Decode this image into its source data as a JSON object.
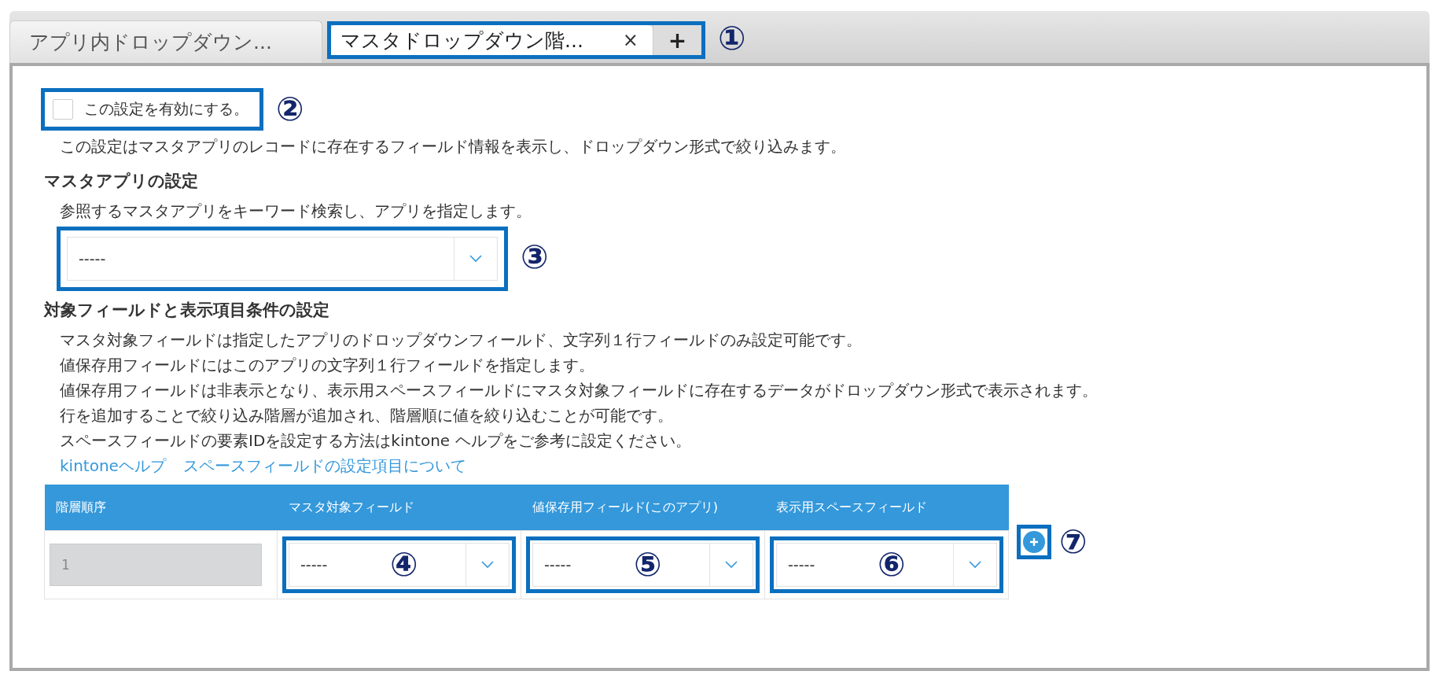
{
  "tab_bar": {
    "tabs": [
      {
        "label": "アプリ内ドロップダウン...",
        "selected": false
      },
      {
        "label": "マスタドロップダウン階...",
        "selected": true,
        "close": "×"
      }
    ],
    "add_button": "+",
    "callout": "①"
  },
  "enable": {
    "label": "この設定を有効にする。",
    "checked": false,
    "callout": "②"
  },
  "description": "この設定はマスタアプリのレコードに存在するフィールド情報を表示し、ドロップダウン形式で絞り込みます。",
  "app_section": {
    "heading": "マスタアプリの設定",
    "lines": [
      "参照するマスタアプリをキーワード検索し、アプリを指定します。"
    ],
    "dropdown": {
      "value": "-----",
      "callout": "③"
    }
  },
  "field_section": {
    "heading": "対象フィールドと表示項目条件の設定",
    "lines": [
      "マスタ対象フィールドは指定したアプリのドロップダウンフィールド、文字列１行フィールドのみ設定可能です。",
      "値保存用フィールドにはこのアプリの文字列１行フィールドを指定します。",
      "値保存用フィールドは非表示となり、表示用スペースフィールドにマスタ対象フィールドに存在するデータがドロップダウン形式で表示されます。",
      "行を追加することで絞り込み階層が追加され、階層順に値を絞り込むことが可能です。",
      "スペースフィールドの要素IDを設定する方法はkintone ヘルプをご参考に設定ください。"
    ],
    "links": [
      "kintoneヘルプ",
      "スペースフィールドの設定項目について"
    ],
    "table": {
      "columns": [
        "階層順序",
        "マスタ対象フィールド",
        "値保存用フィールド(このアプリ)",
        "表示用スペースフィールド"
      ],
      "rows": [
        {
          "order": "1",
          "fields": [
            {
              "value": "-----",
              "callout": "④"
            },
            {
              "value": "-----",
              "callout": "⑤"
            },
            {
              "value": "-----",
              "callout": "⑥"
            }
          ]
        }
      ]
    },
    "add_row": {
      "callout": "⑦"
    }
  }
}
